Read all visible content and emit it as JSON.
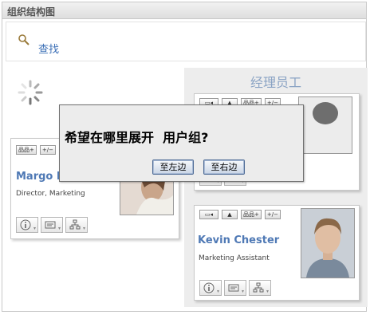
{
  "window": {
    "title": "组织结构图"
  },
  "search": {
    "label": "查找"
  },
  "manager_panel": {
    "title": "经理员工"
  },
  "card_toolbar": {
    "expand_label": "品品+",
    "toggle_label": "+/−"
  },
  "cards": {
    "margo": {
      "name": "Margo M",
      "title": "Director, Marketing"
    },
    "kevin": {
      "name": "Kevin Chester",
      "title": "Marketing Assistant"
    }
  },
  "dialog": {
    "question": "希望在哪里展开  用户组?",
    "left_button": "至左边",
    "right_button": "至右边"
  },
  "colors": {
    "link": "#3b6fb6",
    "name": "#4f79b5",
    "panel_title": "#8aa3c4"
  }
}
